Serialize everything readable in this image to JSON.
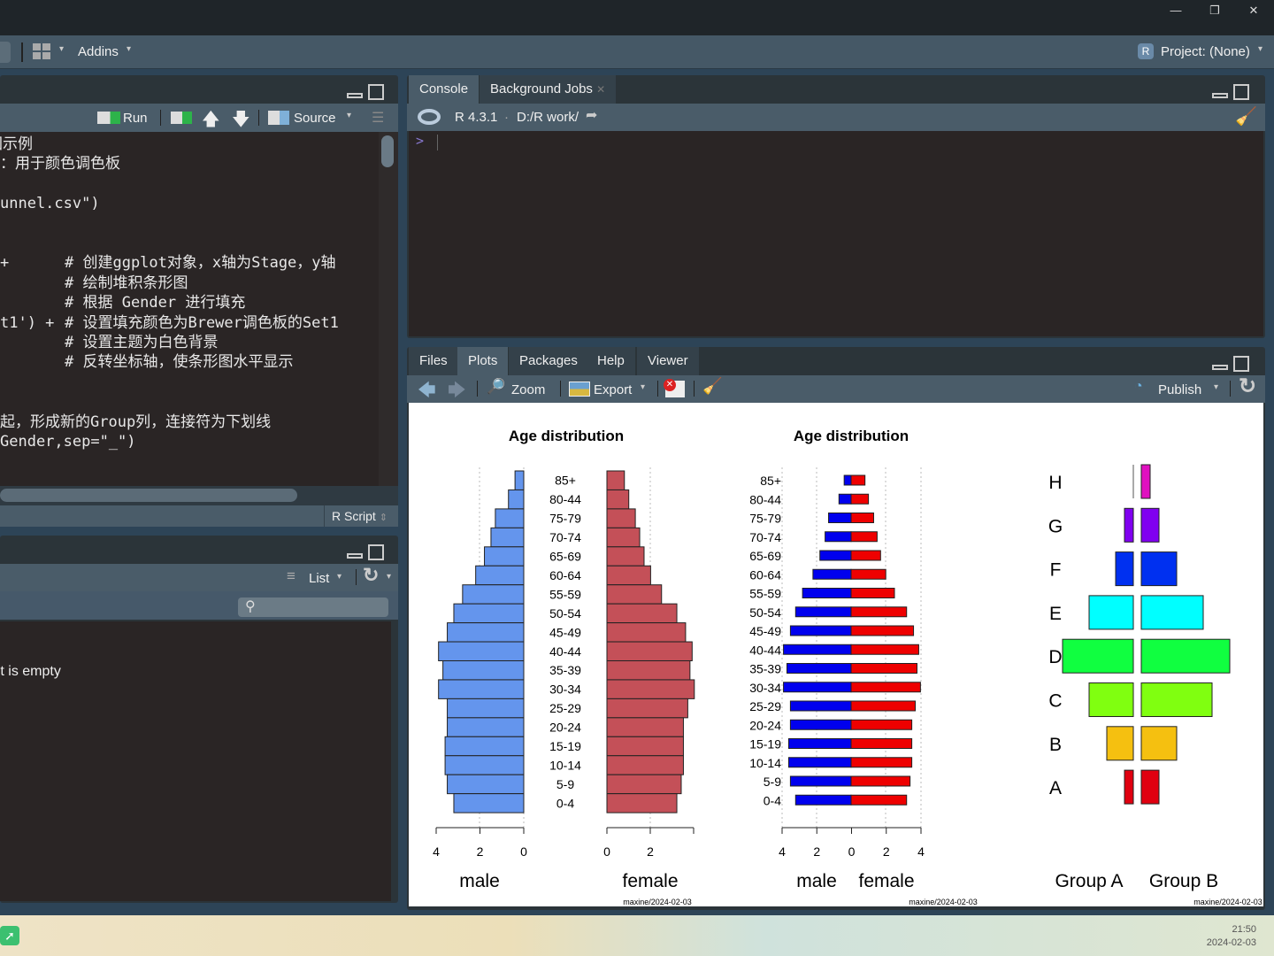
{
  "window": {
    "minimize": "—",
    "restore": "❐",
    "close": "✕"
  },
  "toolbar": {
    "addins": "Addins",
    "project": "Project: (None)"
  },
  "editor": {
    "run": "Run",
    "source": "Source",
    "file_type": "R Script",
    "lines": [
      {
        "code": "图示例",
        "comment": ""
      },
      {
        "code": "：用于颜色调色板",
        "comment": ""
      },
      {
        "code": "",
        "comment": ""
      },
      {
        "code": "unnel.csv\")",
        "comment": ""
      },
      {
        "code": "",
        "comment": ""
      },
      {
        "code": "",
        "comment": ""
      },
      {
        "code": "+",
        "comment": "# 创建ggplot对象，x轴为Stage，y轴"
      },
      {
        "code": "",
        "comment": "# 绘制堆积条形图"
      },
      {
        "code": "",
        "comment": "# 根据 Gender 进行填充"
      },
      {
        "code": "t1') +",
        "comment": "# 设置填充颜色为Brewer调色板的Set1"
      },
      {
        "code": "",
        "comment": "# 设置主题为白色背景"
      },
      {
        "code": "",
        "comment": "# 反转坐标轴，使条形图水平显示"
      },
      {
        "code": "",
        "comment": ""
      },
      {
        "code": "",
        "comment": ""
      },
      {
        "code": "起，形成新的Group列，连接符为下划线",
        "comment": ""
      },
      {
        "code": "Gender,sep=\"_\")",
        "comment": ""
      }
    ]
  },
  "environment": {
    "list": "List",
    "empty_msg": "Environment is empty",
    "search_placeholder": ""
  },
  "console": {
    "tabs": [
      "Console",
      "Background Jobs"
    ],
    "r_version": "R 4.3.1",
    "sep": "·",
    "path": "D:/R work/",
    "prompt": ">"
  },
  "files_pane": {
    "tabs": [
      "Files",
      "Plots",
      "Packages",
      "Help",
      "Viewer"
    ],
    "selected": "Plots",
    "zoom": "Zoom",
    "export": "Export",
    "publish": "Publish"
  },
  "chart_data": [
    {
      "type": "bar",
      "orientation": "horizontal",
      "title": "Age distribution",
      "layout": "split pyramid",
      "categories": [
        "85+",
        "80-44",
        "75-79",
        "70-74",
        "65-69",
        "60-64",
        "55-59",
        "50-54",
        "45-49",
        "40-44",
        "35-39",
        "30-34",
        "25-29",
        "20-24",
        "15-19",
        "10-14",
        "5-9",
        "0-4"
      ],
      "series": [
        {
          "name": "male",
          "color": "#6495ed",
          "values": [
            0.4,
            0.7,
            1.3,
            1.5,
            1.8,
            2.2,
            2.8,
            3.2,
            3.5,
            3.9,
            3.7,
            3.9,
            3.5,
            3.5,
            3.6,
            3.6,
            3.5,
            3.2
          ]
        },
        {
          "name": "female",
          "color": "#c45058",
          "values": [
            0.8,
            1.0,
            1.3,
            1.5,
            1.7,
            2.0,
            2.5,
            3.2,
            3.6,
            3.9,
            3.8,
            4.0,
            3.7,
            3.5,
            3.5,
            3.5,
            3.4,
            3.2
          ]
        }
      ],
      "male_ticks": [
        "4",
        "2",
        "0"
      ],
      "female_ticks": [
        "0",
        "2"
      ],
      "xlim": [
        0,
        4
      ],
      "grid": "dotted vertical",
      "watermark": "maxine/2024-02-03"
    },
    {
      "type": "bar",
      "orientation": "horizontal",
      "title": "Age distribution",
      "layout": "back-to-back pyramid",
      "categories": [
        "85+",
        "80-44",
        "75-79",
        "70-74",
        "65-69",
        "60-64",
        "55-59",
        "50-54",
        "45-49",
        "40-44",
        "35-39",
        "30-34",
        "25-29",
        "20-24",
        "15-19",
        "10-14",
        "5-9",
        "0-4"
      ],
      "series": [
        {
          "name": "male",
          "color": "#0000ee",
          "values": [
            0.4,
            0.7,
            1.3,
            1.5,
            1.8,
            2.2,
            2.8,
            3.2,
            3.5,
            3.9,
            3.7,
            3.9,
            3.5,
            3.5,
            3.6,
            3.6,
            3.5,
            3.2
          ]
        },
        {
          "name": "female",
          "color": "#ee0000",
          "values": [
            0.8,
            1.0,
            1.3,
            1.5,
            1.7,
            2.0,
            2.5,
            3.2,
            3.6,
            3.9,
            3.8,
            4.0,
            3.7,
            3.5,
            3.5,
            3.5,
            3.4,
            3.2
          ]
        }
      ],
      "ticks": [
        "4",
        "2",
        "0",
        "2",
        "4"
      ],
      "xlim": [
        -4,
        4
      ],
      "grid": "dotted vertical",
      "watermark": "maxine/2024-02-03"
    },
    {
      "type": "bar",
      "orientation": "horizontal",
      "layout": "back-to-back funnel",
      "categories": [
        "H",
        "G",
        "F",
        "E",
        "D",
        "C",
        "B",
        "A"
      ],
      "colors": [
        "#e010c0",
        "#8000f0",
        "#0030f0",
        "#00ffff",
        "#10ff40",
        "#80ff10",
        "#f5c010",
        "#e00010"
      ],
      "series": [
        {
          "name": "Group A",
          "values": [
            0,
            1,
            2,
            5,
            8,
            5,
            3,
            1
          ]
        },
        {
          "name": "Group B",
          "values": [
            1,
            2,
            4,
            7,
            10,
            8,
            4,
            2
          ]
        }
      ],
      "watermark": "maxine/2024-02-03"
    }
  ],
  "taskbar": {
    "time": "21:50",
    "date": "2024-02-03"
  }
}
